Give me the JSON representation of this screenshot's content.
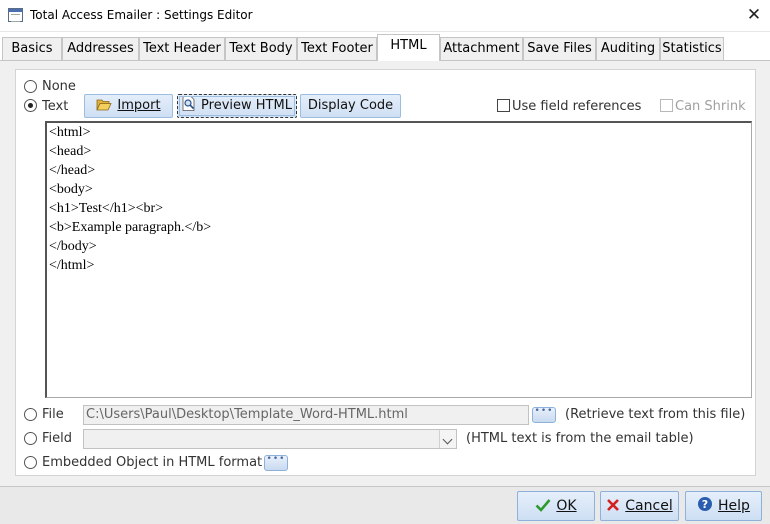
{
  "window": {
    "title": "Total Access Emailer : Settings Editor",
    "close_label": "✕"
  },
  "tabs": [
    {
      "label": "Basics"
    },
    {
      "label": "Addresses"
    },
    {
      "label": "Text Header"
    },
    {
      "label": "Text Body"
    },
    {
      "label": "Text Footer"
    },
    {
      "label": "HTML"
    },
    {
      "label": "Attachment"
    },
    {
      "label": "Save Files"
    },
    {
      "label": "Auditing"
    },
    {
      "label": "Statistics"
    }
  ],
  "active_tab": "HTML",
  "options": {
    "none_label": "None",
    "text_label": "Text",
    "selected": "Text"
  },
  "toolbar": {
    "import_label": "Import",
    "preview_label": "Preview HTML",
    "display_code_label": "Display Code",
    "use_field_refs_label": "Use field references",
    "use_field_refs_checked": false,
    "can_shrink_label": "Can Shrink",
    "can_shrink_checked": false
  },
  "editor": {
    "lines": [
      "<html>",
      "<head>",
      "</head>",
      "<body>",
      "<h1>Test</h1><br>",
      "<b>Example paragraph.</b>",
      "</body>",
      "</html>"
    ]
  },
  "file": {
    "label": "File",
    "value": "C:\\Users\\Paul\\Desktop\\Template_Word-HTML.html",
    "hint": "(Retrieve text from this file)"
  },
  "field": {
    "label": "Field",
    "value": "",
    "hint": "(HTML text is from the email table)"
  },
  "embedded": {
    "label": "Embedded Object in HTML format"
  },
  "footer": {
    "ok_label": "OK",
    "cancel_label": "Cancel",
    "help_label": "Help"
  },
  "colors": {
    "ok_icon": "#2e9a2e",
    "cancel_icon": "#d42020",
    "help_icon": "#2a5db0"
  }
}
